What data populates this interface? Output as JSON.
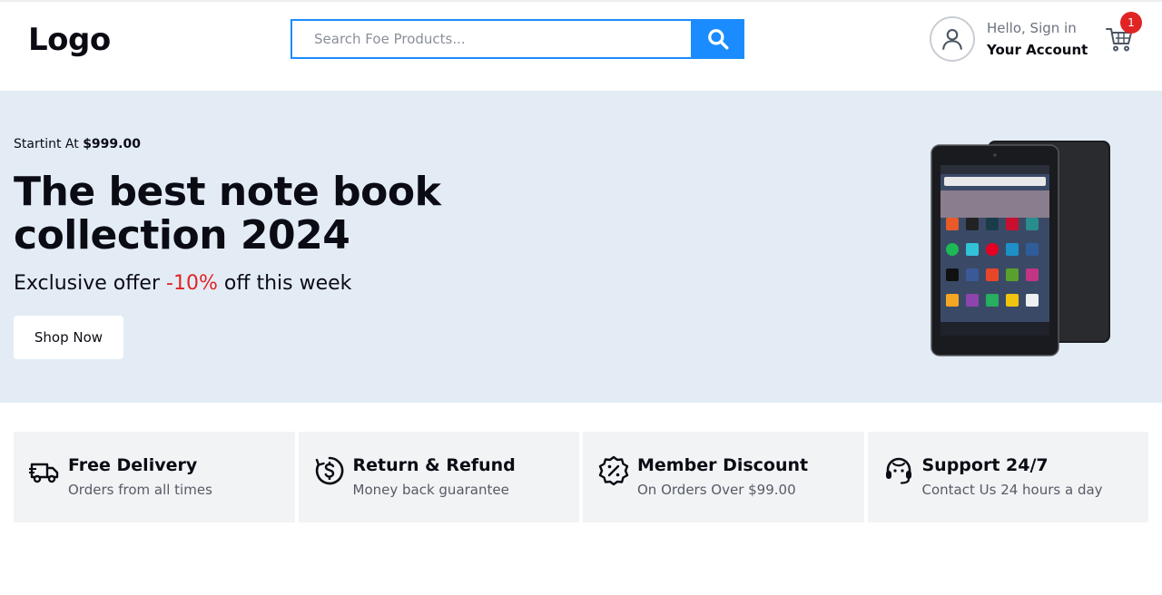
{
  "header": {
    "logo": "Logo",
    "search": {
      "placeholder": "Search Foe Products..."
    },
    "account": {
      "hello": "Hello, Sign in",
      "label": "Your Account"
    },
    "cart": {
      "count": "1"
    }
  },
  "hero": {
    "starting_prefix": "Startint At",
    "starting_price": "$999.00",
    "title": "The best note book collection 2024",
    "offer_prefix": "Exclusive offer",
    "offer_percent": "-10%",
    "offer_suffix": "off this week",
    "cta": "Shop Now"
  },
  "features": [
    {
      "icon": "delivery-truck-icon",
      "title": "Free Delivery",
      "subtitle": "Orders from all times"
    },
    {
      "icon": "dollar-refund-icon",
      "title": "Return & Refund",
      "subtitle": "Money back guarantee"
    },
    {
      "icon": "discount-badge-icon",
      "title": "Member Discount",
      "subtitle": "On Orders Over $99.00"
    },
    {
      "icon": "headset-support-icon",
      "title": "Support 24/7",
      "subtitle": "Contact Us 24 hours a day"
    }
  ],
  "colors": {
    "accent": "#1a8cff",
    "badge": "#e02424",
    "hero_bg": "#e3ecf5",
    "feature_bg": "#f2f3f5"
  }
}
